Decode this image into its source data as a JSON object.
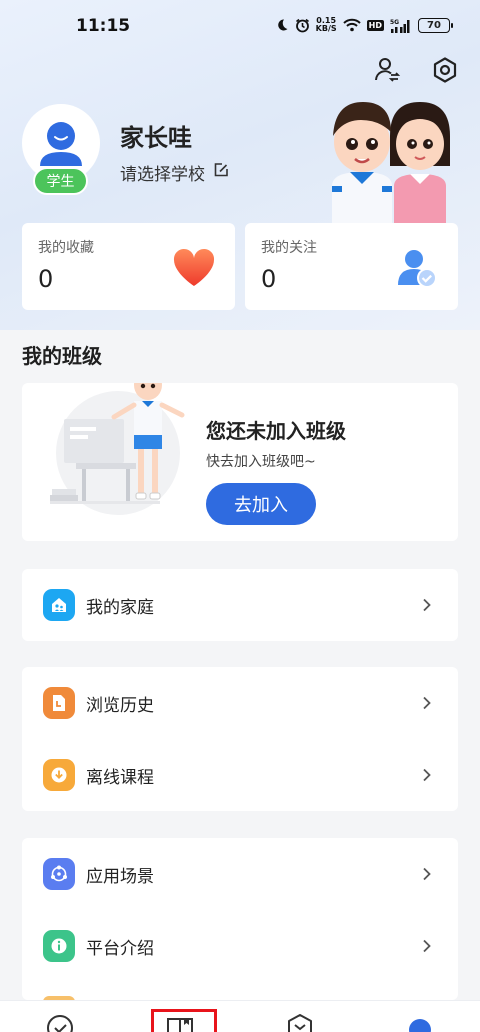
{
  "status_bar": {
    "time": "11:15",
    "net_speed_value": "0.15",
    "net_speed_unit": "KB/S",
    "hd": "HD",
    "signal": "5G",
    "battery": "70",
    "icons": [
      "moon-icon",
      "alarm-icon",
      "wifi-icon",
      "signal-icon",
      "battery-icon"
    ]
  },
  "header": {
    "actions": [
      "switch-user-icon",
      "settings-icon"
    ]
  },
  "profile": {
    "name": "家长哇",
    "role_badge": "学生",
    "school_prompt": "请选择学校"
  },
  "stats": {
    "favorites": {
      "label": "我的收藏",
      "value": "0",
      "icon": "heart-icon"
    },
    "following": {
      "label": "我的关注",
      "value": "0",
      "icon": "user-check-icon"
    }
  },
  "my_class": {
    "section_title": "我的班级",
    "empty_title": "您还未加入班级",
    "empty_subtitle": "快去加入班级吧~",
    "join_button": "去加入"
  },
  "menu_groups": [
    {
      "items": [
        {
          "label": "我的家庭",
          "icon": "home-icon",
          "color": "#1da7f2"
        }
      ]
    },
    {
      "items": [
        {
          "label": "浏览历史",
          "icon": "history-doc-icon",
          "color": "#f08a3a"
        },
        {
          "label": "离线课程",
          "icon": "download-icon",
          "color": "#f7a93a"
        }
      ]
    },
    {
      "items": [
        {
          "label": "应用场景",
          "icon": "scene-icon",
          "color": "#5a7df0"
        },
        {
          "label": "平台介绍",
          "icon": "info-icon",
          "color": "#3cc48a"
        }
      ]
    }
  ],
  "bottom_nav": [
    "check-circle-icon",
    "book-icon",
    "badge-icon",
    "profile-icon"
  ],
  "colors": {
    "accent": "#2f6be0",
    "badge_green": "#4cc45b",
    "heart": "#f2553c",
    "highlight": "#e8141b"
  }
}
